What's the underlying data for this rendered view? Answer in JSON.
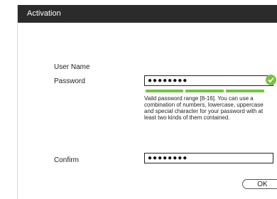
{
  "dialog": {
    "title": "Activation"
  },
  "form": {
    "user_name_label": "User Name",
    "password_label": "Password",
    "password_value": "●●●●●●●●",
    "confirm_label": "Confirm",
    "confirm_value": "●●●●●●●●",
    "strength_level": 1.0,
    "hint": "Vaild password  range [8-16]. You can use a combination of numbers, lowercase, uppercase and special character for your password with at least two kinds of them contained."
  },
  "buttons": {
    "ok_label": "OK"
  },
  "colors": {
    "titlebar": "#2b2b2b",
    "strength": "#7ac143",
    "valid": "#7ac143"
  },
  "icons": {
    "password_valid": "check-circle-icon"
  }
}
